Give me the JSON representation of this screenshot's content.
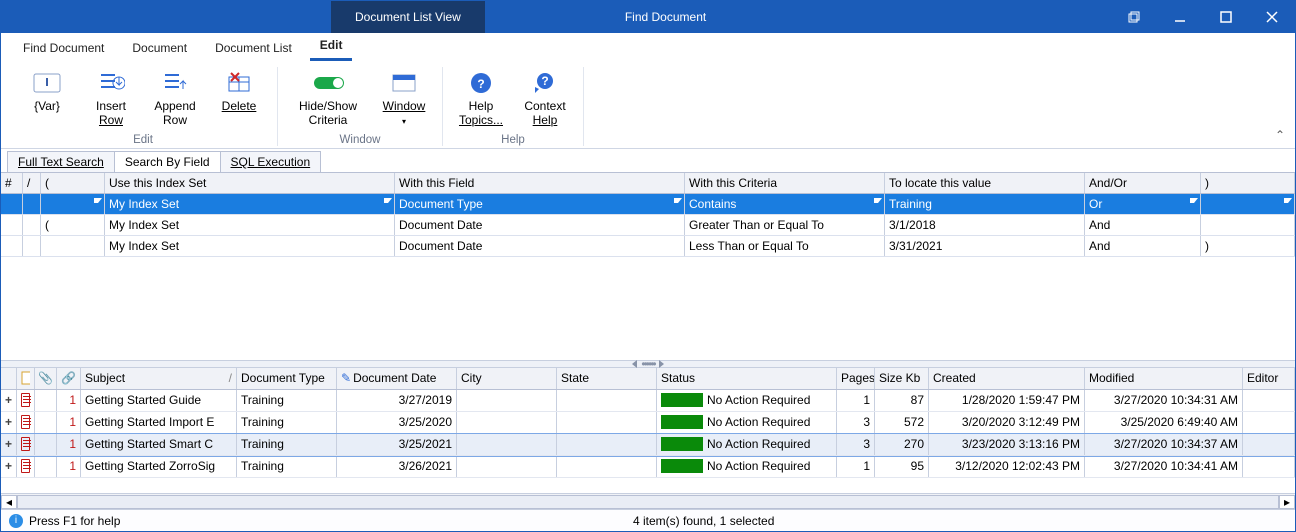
{
  "titlebar": {
    "tab": "Document List View",
    "title": "Find Document"
  },
  "ribbon_tabs": {
    "find": "Find Document",
    "document": "Document",
    "doclist": "Document List",
    "edit": "Edit"
  },
  "ribbon": {
    "var": "{Var}",
    "insert_row_1": "Insert",
    "insert_row_2": "Row",
    "append_row_1": "Append",
    "append_row_2": "Row",
    "delete": "Delete",
    "hideshow_1": "Hide/Show",
    "hideshow_2": "Criteria",
    "window": "Window",
    "help_topics_1": "Help",
    "help_topics_2": "Topics...",
    "context_help_1": "Context",
    "context_help_2": "Help",
    "group_edit": "Edit",
    "group_window": "Window",
    "group_help": "Help"
  },
  "search_tabs": {
    "full": "Full Text Search",
    "field": "Search By Field",
    "sql": "SQL Execution"
  },
  "criteria_headers": {
    "hash": "#",
    "slash": "/",
    "paren_l": "(",
    "index": "Use this Index Set",
    "field": "With this Field",
    "crit": "With this Criteria",
    "val": "To locate this value",
    "andor": "And/Or",
    "paren_r": ")"
  },
  "criteria_rows": [
    {
      "paren": "",
      "index": "My Index Set",
      "field": "Document Type",
      "crit": "Contains",
      "val": "Training",
      "andor": "Or",
      "pr": ""
    },
    {
      "paren": "(",
      "index": "My Index Set",
      "field": "Document Date",
      "crit": "Greater Than or Equal To",
      "val": "3/1/2018",
      "andor": "And",
      "pr": ""
    },
    {
      "paren": "",
      "index": "My Index Set",
      "field": "Document Date",
      "crit": "Less Than or Equal To",
      "val": "3/31/2021",
      "andor": "And",
      "pr": ")"
    }
  ],
  "results_headers": {
    "subject": "Subject",
    "doctype": "Document Type",
    "docdate": "Document Date",
    "city": "City",
    "state": "State",
    "status": "Status",
    "pages": "Pages",
    "size": "Size Kb",
    "created": "Created",
    "modified": "Modified",
    "editor": "Editor"
  },
  "results_rows": [
    {
      "num": "1",
      "subject": "Getting Started Guide",
      "doctype": "Training",
      "docdate": "3/27/2019",
      "city": "",
      "state": "",
      "status": "No Action Required",
      "pages": "1",
      "size": "87",
      "created": "1/28/2020 1:59:47 PM",
      "modified": "3/27/2020 10:34:31 AM"
    },
    {
      "num": "1",
      "subject": "Getting Started Import E",
      "doctype": "Training",
      "docdate": "3/25/2020",
      "city": "",
      "state": "",
      "status": "No Action Required",
      "pages": "3",
      "size": "572",
      "created": "3/20/2020 3:12:49 PM",
      "modified": "3/25/2020 6:49:40 AM"
    },
    {
      "num": "1",
      "subject": "Getting Started Smart C",
      "doctype": "Training",
      "docdate": "3/25/2021",
      "city": "",
      "state": "",
      "status": "No Action Required",
      "pages": "3",
      "size": "270",
      "created": "3/23/2020 3:13:16 PM",
      "modified": "3/27/2020 10:34:37 AM"
    },
    {
      "num": "1",
      "subject": "Getting Started ZorroSig",
      "doctype": "Training",
      "docdate": "3/26/2021",
      "city": "",
      "state": "",
      "status": "No Action Required",
      "pages": "1",
      "size": "95",
      "created": "3/12/2020 12:02:43 PM",
      "modified": "3/27/2020 10:34:41 AM"
    }
  ],
  "statusbar": {
    "help": "Press F1 for help",
    "summary": "4 item(s) found, 1 selected"
  }
}
